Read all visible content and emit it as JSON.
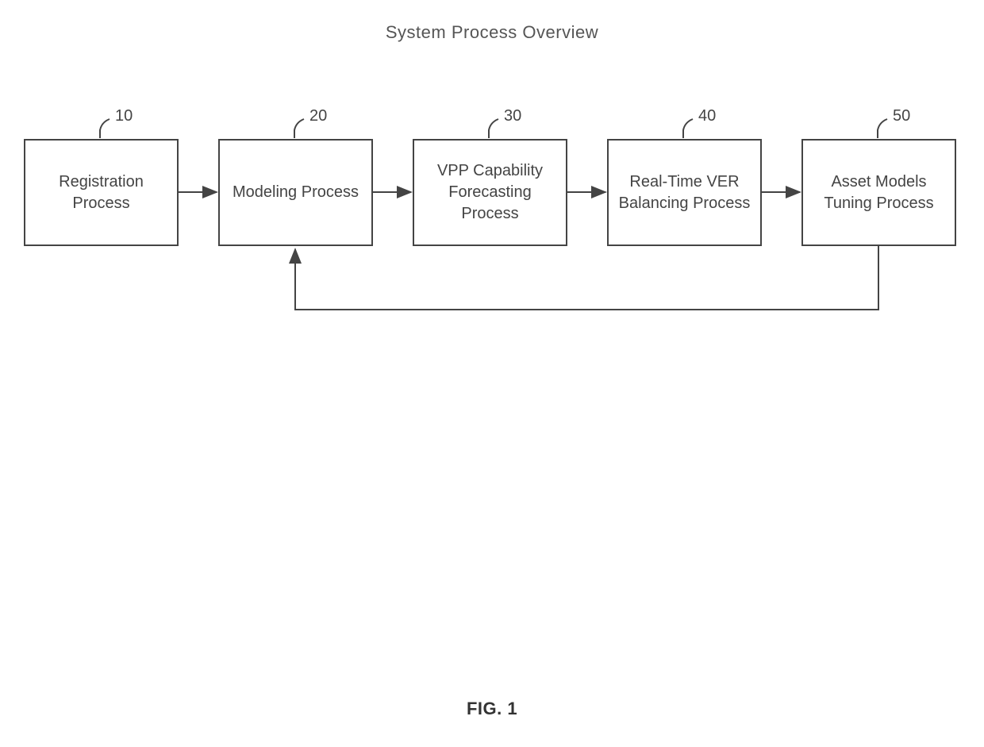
{
  "title": "System Process Overview",
  "figure_label": "FIG. 1",
  "boxes": [
    {
      "id": "b1",
      "num": "10",
      "label": "Registration Process"
    },
    {
      "id": "b2",
      "num": "20",
      "label": "Modeling Process"
    },
    {
      "id": "b3",
      "num": "30",
      "label": "VPP Capability Forecasting Process"
    },
    {
      "id": "b4",
      "num": "40",
      "label": "Real-Time VER Balancing Process"
    },
    {
      "id": "b5",
      "num": "50",
      "label": "Asset Models Tuning Process"
    }
  ]
}
